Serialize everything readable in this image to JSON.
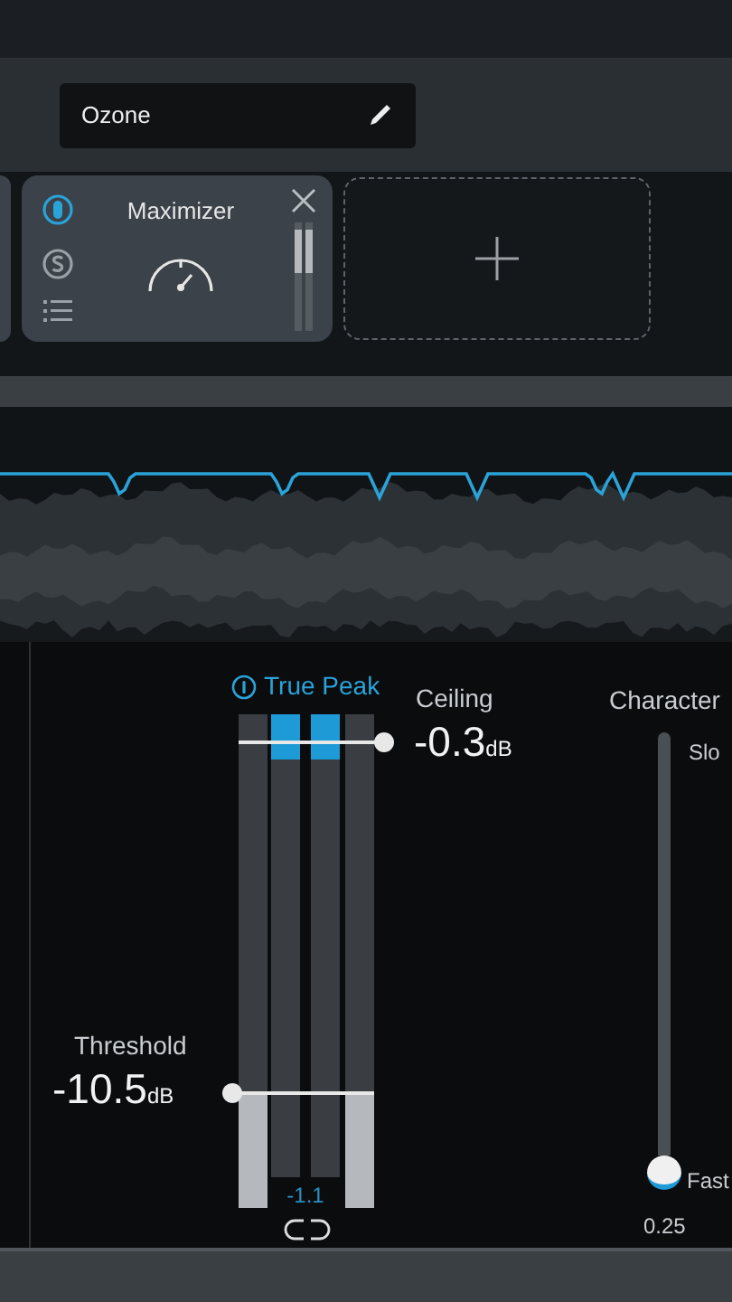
{
  "preset": {
    "name": "Ozone"
  },
  "module": {
    "title": "Maximizer",
    "power_on": true,
    "solo": false
  },
  "meter": {
    "title": "True Peak",
    "true_peak_on": true,
    "ceiling": {
      "label": "Ceiling",
      "value": "-0.3",
      "unit": "dB"
    },
    "threshold": {
      "label": "Threshold",
      "value": "-10.5",
      "unit": "dB"
    },
    "bars": [
      {
        "kind": "input",
        "level": 0.23
      },
      {
        "kind": "reduction",
        "level": 0.09
      },
      {
        "kind": "reduction",
        "level": 0.09
      },
      {
        "kind": "input",
        "level": 0.23
      }
    ],
    "gain_reduction": "-1.1"
  },
  "character": {
    "label": "Character",
    "slow_label": "Slo",
    "fast_label": "Fast",
    "value": "0.25"
  }
}
